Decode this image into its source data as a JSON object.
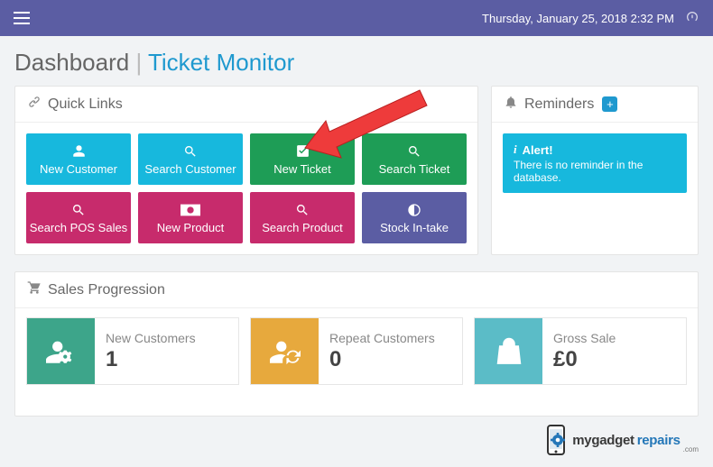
{
  "topbar": {
    "datetime": "Thursday, January 25, 2018 2:32 PM"
  },
  "page": {
    "title": "Dashboard",
    "subtitle": "Ticket Monitor"
  },
  "quicklinks": {
    "header": "Quick Links",
    "items": [
      {
        "label": "New Customer"
      },
      {
        "label": "Search Customer"
      },
      {
        "label": "New Ticket"
      },
      {
        "label": "Search Ticket"
      },
      {
        "label": "Search POS Sales"
      },
      {
        "label": "New Product"
      },
      {
        "label": "Search Product"
      },
      {
        "label": "Stock In-take"
      }
    ]
  },
  "reminders": {
    "header": "Reminders",
    "alert_title": "Alert!",
    "alert_msg": "There is no reminder in the database."
  },
  "sales": {
    "header": "Sales Progression",
    "cards": [
      {
        "label": "New Customers",
        "value": "1"
      },
      {
        "label": "Repeat Customers",
        "value": "0"
      },
      {
        "label": "Gross Sale",
        "value": "£0"
      }
    ]
  },
  "brand": {
    "part1": "mygadget",
    "part2": "repairs",
    "suffix": ".com"
  }
}
